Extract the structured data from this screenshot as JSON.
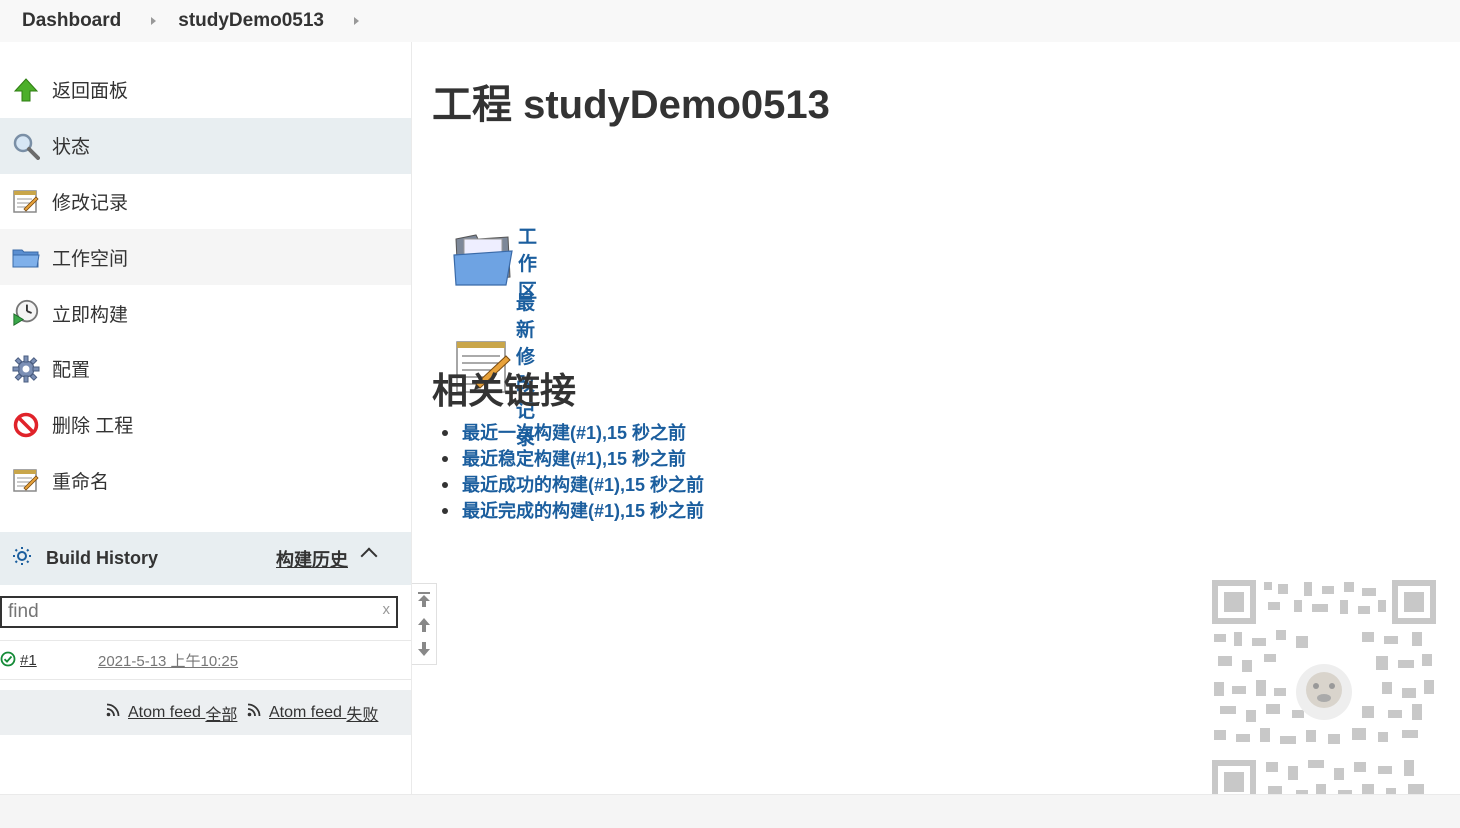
{
  "breadcrumb": {
    "items": [
      "Dashboard",
      "studyDemo0513"
    ]
  },
  "sidebar": {
    "tasks": [
      {
        "label": "返回面板",
        "icon": "up-arrow-icon"
      },
      {
        "label": "状态",
        "icon": "magnifier-icon"
      },
      {
        "label": "修改记录",
        "icon": "notepad-icon"
      },
      {
        "label": "工作空间",
        "icon": "folder-icon"
      },
      {
        "label": "立即构建",
        "icon": "build-clock-icon"
      },
      {
        "label": "配置",
        "icon": "gear-icon"
      },
      {
        "label": "删除 工程",
        "icon": "no-entry-icon"
      },
      {
        "label": "重命名",
        "icon": "notepad-pencil-icon"
      }
    ]
  },
  "build_history": {
    "title": "Build History",
    "trend_label": "构建历史",
    "find_placeholder": "find",
    "clear_label": "x",
    "builds": [
      {
        "number": "#1",
        "time": "2021-5-13 上午10:25"
      }
    ],
    "feeds": {
      "all_prefix": "Atom feed",
      "all_suffix": "全部",
      "fail_prefix": "Atom feed",
      "fail_suffix": "失败"
    }
  },
  "main": {
    "title": "工程 studyDemo0513",
    "workspace_link": "工作区",
    "changes_link": "最新修改记录",
    "related_heading": "相关链接",
    "related_links": [
      "最近一次构建(#1),15 秒之前",
      "最近稳定构建(#1),15 秒之前",
      "最近成功的构建(#1),15 秒之前",
      "最近完成的构建(#1),15 秒之前"
    ]
  },
  "colors": {
    "link": "#1b5e9e",
    "success": "#138a36",
    "active_bg": "#e8eef1"
  }
}
